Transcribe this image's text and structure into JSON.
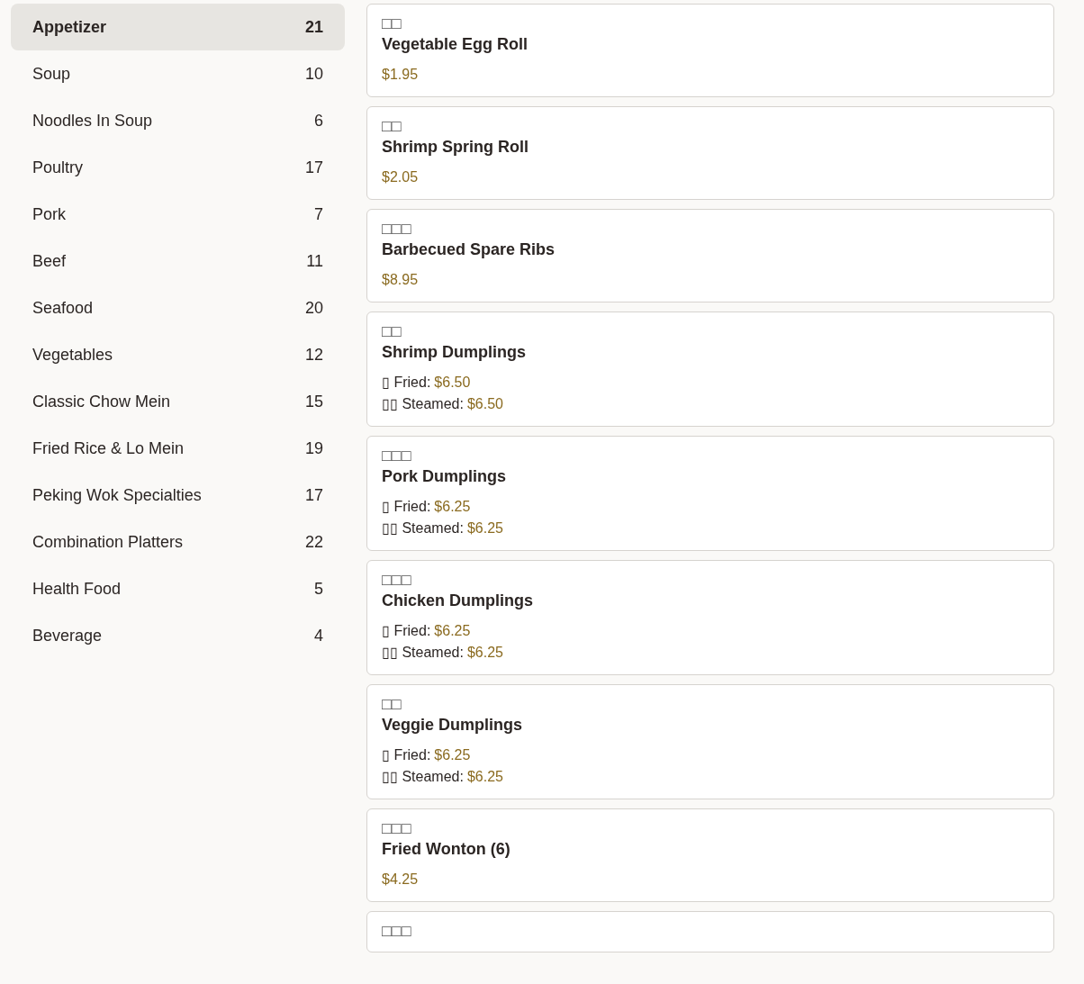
{
  "categories": [
    {
      "name": "Appetizer",
      "count": "21",
      "selected": true
    },
    {
      "name": "Soup",
      "count": "10",
      "selected": false
    },
    {
      "name": "Noodles In Soup",
      "count": "6",
      "selected": false
    },
    {
      "name": "Poultry",
      "count": "17",
      "selected": false
    },
    {
      "name": "Pork",
      "count": "7",
      "selected": false
    },
    {
      "name": "Beef",
      "count": "11",
      "selected": false
    },
    {
      "name": "Seafood",
      "count": "20",
      "selected": false
    },
    {
      "name": "Vegetables",
      "count": "12",
      "selected": false
    },
    {
      "name": "Classic Chow Mein",
      "count": "15",
      "selected": false
    },
    {
      "name": "Fried Rice & Lo Mein",
      "count": "19",
      "selected": false
    },
    {
      "name": "Peking Wok Specialties",
      "count": "17",
      "selected": false
    },
    {
      "name": "Combination Platters",
      "count": "22",
      "selected": false
    },
    {
      "name": "Health Food",
      "count": "5",
      "selected": false
    },
    {
      "name": "Beverage",
      "count": "4",
      "selected": false
    }
  ],
  "items": [
    {
      "kind": "single",
      "native_name": "□□",
      "name": "Vegetable Egg Roll",
      "price": "$1.95"
    },
    {
      "kind": "single",
      "native_name": "□□",
      "name": "Shrimp Spring Roll",
      "price": "$2.05"
    },
    {
      "kind": "single",
      "native_name": "□□□",
      "name": "Barbecued Spare Ribs",
      "price": "$8.95"
    },
    {
      "kind": "options",
      "native_name": "□□",
      "name": "Shrimp Dumplings",
      "options": [
        {
          "label": "▯ Fried:",
          "price": "$6.50"
        },
        {
          "label": "▯▯ Steamed:",
          "price": "$6.50"
        }
      ]
    },
    {
      "kind": "options",
      "native_name": "□□□",
      "name": "Pork Dumplings",
      "options": [
        {
          "label": "▯ Fried:",
          "price": "$6.25"
        },
        {
          "label": "▯▯ Steamed:",
          "price": "$6.25"
        }
      ]
    },
    {
      "kind": "options",
      "native_name": "□□□",
      "name": "Chicken Dumplings",
      "options": [
        {
          "label": "▯ Fried:",
          "price": "$6.25"
        },
        {
          "label": "▯▯ Steamed:",
          "price": "$6.25"
        }
      ]
    },
    {
      "kind": "options",
      "native_name": "□□",
      "name": "Veggie Dumplings",
      "options": [
        {
          "label": "▯ Fried:",
          "price": "$6.25"
        },
        {
          "label": "▯▯ Steamed:",
          "price": "$6.25"
        }
      ]
    },
    {
      "kind": "single",
      "native_name": "□□□",
      "name": "Fried Wonton (6)",
      "price": "$4.25"
    },
    {
      "kind": "partial",
      "native_name": "□□□"
    }
  ]
}
